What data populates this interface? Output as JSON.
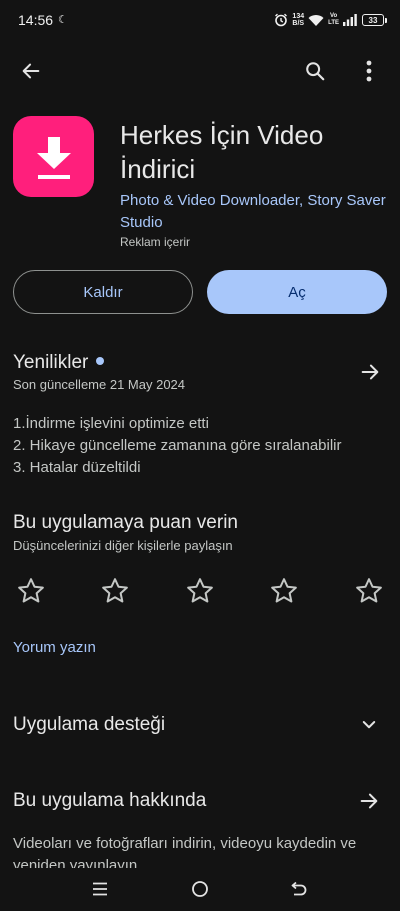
{
  "status_bar": {
    "time": "14:56",
    "net_speed_value": "134",
    "net_speed_unit": "B/S",
    "volte_top": "Vo",
    "volte_bottom": "LTE",
    "battery": "33"
  },
  "app": {
    "title": "Herkes İçin Video İndirici",
    "developer": "Photo & Video Downloader, Story Saver Studio",
    "ads_note": "Reklam içerir",
    "icon_color": "#ff1f7c"
  },
  "actions": {
    "uninstall_label": "Kaldır",
    "open_label": "Aç"
  },
  "whats_new": {
    "title": "Yenilikler",
    "last_updated": "Son güncelleme 21 May 2024",
    "notes": [
      "1.İndirme işlevini optimize etti",
      "2. Hikaye güncelleme zamanına göre sıralanabilir",
      "3. Hatalar düzeltildi"
    ]
  },
  "rate": {
    "title": "Bu uygulamaya puan verin",
    "subtitle": "Düşüncelerinizi diğer kişilerle paylaşın",
    "write_review": "Yorum yazın"
  },
  "support": {
    "title": "Uygulama desteği"
  },
  "about": {
    "title": "Bu uygulama hakkında",
    "description": "Videoları ve fotoğrafları indirin, videoyu kaydedin ve yeniden yayınlayın"
  },
  "colors": {
    "background": "#131313",
    "accent": "#a8c7fa",
    "on_accent": "#062e6f"
  }
}
